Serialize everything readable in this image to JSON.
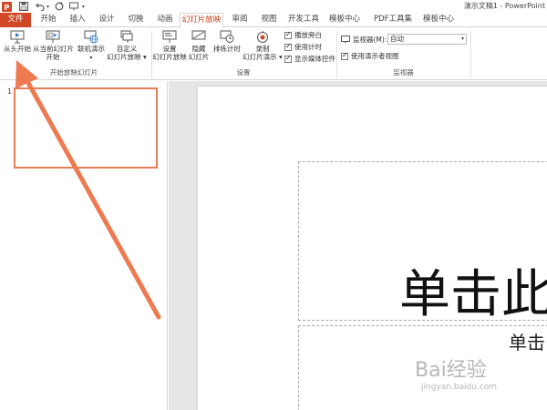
{
  "window": {
    "title": "演示文稿1 - PowerPoint"
  },
  "tabs": [
    {
      "label": "文件"
    },
    {
      "label": "开始"
    },
    {
      "label": "插入"
    },
    {
      "label": "设计"
    },
    {
      "label": "切换"
    },
    {
      "label": "动画"
    },
    {
      "label": "幻灯片放映"
    },
    {
      "label": "审阅"
    },
    {
      "label": "视图"
    },
    {
      "label": "开发工具"
    },
    {
      "label": "模板中心"
    },
    {
      "label": "PDF工具集"
    },
    {
      "label": "模板中心"
    }
  ],
  "ribbon": {
    "start_group": {
      "label": "开始放映幻灯片",
      "from_beginning": "从头开始",
      "from_current_1": "从当前幻灯片",
      "from_current_2": "开始",
      "online_1": "联机演示",
      "online_2": "▾",
      "custom_1": "自定义",
      "custom_2": "幻灯片放映 ▾"
    },
    "setup_group": {
      "label": "设置",
      "setup_1": "设置",
      "setup_2": "幻灯片放映",
      "hide_1": "隐藏",
      "hide_2": "幻灯片",
      "rehearse": "排练计时",
      "record_1": "录制",
      "record_2": "幻灯片演示 ▾",
      "play_narration": "播放旁白",
      "use_timings": "使用计时",
      "show_media": "显示媒体控件"
    },
    "monitor_group": {
      "label": "监视器",
      "monitor_label": "监视器(M):",
      "monitor_value": "自动",
      "presenter_view": "使用演示者视图"
    }
  },
  "thumbnails": [
    {
      "number": "1"
    }
  ],
  "slide": {
    "title_text": "单击此",
    "subtitle_text": "单击"
  },
  "watermark": {
    "brand": "Bai经验",
    "url": "jingyan.baidu.com"
  },
  "colors": {
    "file_tab": "#d24726",
    "active_tab_text": "#c43e1c",
    "annotation_arrow": "#ee7a50",
    "thumbnail_border": "#e77c57"
  }
}
